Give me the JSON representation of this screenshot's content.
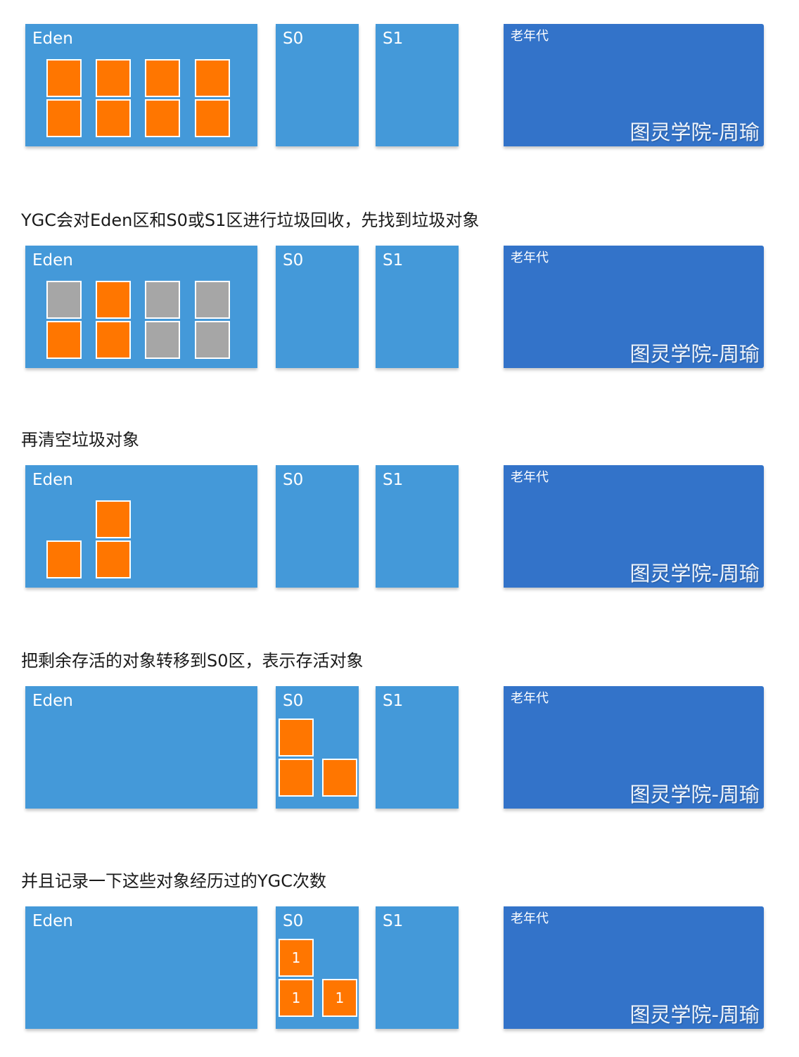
{
  "captions": [
    "YGC会对Eden区和S0或S1区进行垃圾回收，先找到垃圾对象",
    "再清空垃圾对象",
    "把剩余存活的对象转移到S0区，表示存活对象",
    "并且记录一下这些对象经历过的YGC次数"
  ],
  "regions": {
    "eden": "Eden",
    "s0": "S0",
    "s1": "S1",
    "old": "老年代"
  },
  "watermark": "图灵学院-周瑜",
  "colors": {
    "young": "#4499d9",
    "old": "#3373c9",
    "live_object": "#ff7600",
    "garbage_object": "#a6a6a6"
  },
  "stages": [
    {
      "eden": [
        {
          "state": "live"
        },
        {
          "state": "live"
        },
        {
          "state": "live"
        },
        {
          "state": "live"
        },
        {
          "state": "live"
        },
        {
          "state": "live"
        },
        {
          "state": "live"
        },
        {
          "state": "live"
        }
      ],
      "s0": []
    },
    {
      "eden": [
        {
          "state": "garbage"
        },
        {
          "state": "live"
        },
        {
          "state": "garbage"
        },
        {
          "state": "garbage"
        },
        {
          "state": "live"
        },
        {
          "state": "live"
        },
        {
          "state": "garbage"
        },
        {
          "state": "garbage"
        }
      ],
      "s0": []
    },
    {
      "eden": [
        {
          "state": "live"
        },
        {
          "state": "live"
        },
        {
          "state": "live"
        }
      ],
      "s0": []
    },
    {
      "eden": [],
      "s0": [
        {
          "state": "live"
        },
        {
          "state": "live"
        },
        {
          "state": "live"
        }
      ]
    },
    {
      "eden": [],
      "s0": [
        {
          "state": "live",
          "age": "1"
        },
        {
          "state": "live",
          "age": "1"
        },
        {
          "state": "live",
          "age": "1"
        }
      ]
    }
  ]
}
